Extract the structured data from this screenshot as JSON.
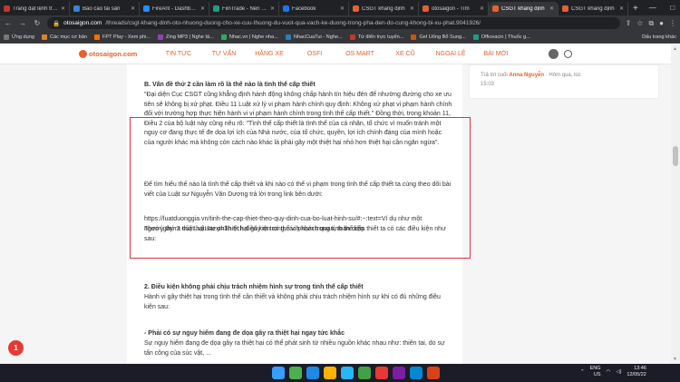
{
  "tabs": [
    {
      "title": "Trang đặt lệnh trực",
      "color": "#c0392b"
    },
    {
      "title": "Báo cáo tài sản",
      "color": "#2e86de"
    },
    {
      "title": "FireAnt - Dashboard",
      "color": "#1e90ff"
    },
    {
      "title": "FiinTrade - Nền tảng",
      "color": "#16a085"
    },
    {
      "title": "Facebook",
      "color": "#1877f2"
    },
    {
      "title": "CSGT khẳng định",
      "color": "#e8612c"
    },
    {
      "title": "otosaigon - Tìm",
      "color": "#e8612c"
    },
    {
      "title": "CSGT khẳng định",
      "color": "#e8612c",
      "active": true
    },
    {
      "title": "CSGT khẳng định",
      "color": "#e8612c"
    }
  ],
  "address": {
    "domain": "otosaigon.com",
    "path": "/threads/csgt-khang-dinh-oto-nhuong-duong-cho-xe-cuu-thuong-du-vuot-qua-vach-ke-duong-trong-pha-den-do-cung-khong-bi-xu-phat.9041926/"
  },
  "bookmarks": [
    {
      "label": "Ứng dụng",
      "color": "#777"
    },
    {
      "label": "Các mục cơ bản",
      "color": "#e67e22"
    },
    {
      "label": "FPT Play - Xem phi...",
      "color": "#ff6f00"
    },
    {
      "label": "Zing MP3 | Nghe tả...",
      "color": "#8e44ad"
    },
    {
      "label": "Nhac.vn | Nghe nha...",
      "color": "#27ae60"
    },
    {
      "label": "NhacCuaTui - Nghe...",
      "color": "#2980b9"
    },
    {
      "label": "Từ điển trực tuyến...",
      "color": "#c0392b"
    },
    {
      "label": "Gel Uống Bổ Sung...",
      "color": "#d35400"
    },
    {
      "label": "Officeacin | Thuốc g...",
      "color": "#16a085"
    }
  ],
  "bookmarks_right": "Dấu trang khác",
  "site": {
    "logo": "otosaigon.com",
    "menu": [
      "TIN TỨC",
      "TƯ VẤN",
      "HÃNG XE",
      "OSFI",
      "OS MART",
      "XE CŨ",
      "NGOẠI LỆ",
      "BÀI MỚI"
    ]
  },
  "sidebar": {
    "reply_prefix": "Trả lời cuối",
    "user": "Anna Nguyễn",
    "reply_suffix": "· Hôm qua, lúc",
    "time": "15:03"
  },
  "article": {
    "heading_b": "B. Vấn đề thứ 2 cần làm rõ là thế nào là tình thế cấp thiết",
    "para_b": "\"Đại diện Cục CSGT cũng khẳng định hành động không chấp hành tín hiệu đèn để nhường đường cho xe ưu tiên sẽ không bị xử phạt. Điều 11 Luật xử lý vi phạm hành chính quy định: Không xử phạt vi phạm hành chính đối với trường hợp thực hiện hành vi vi phạm hành chính trong tình thế cấp thiết.\" Đồng thời, trong khoản 11, Điều 2 của bộ luật này cũng nêu rõ: \"Tình thế cấp thiết là tình thế của cá nhân, tổ chức vì muốn tránh một nguy cơ đang thực tế đe dọa lợi ích của Nhà nước, của tổ chức, quyền, lợi ích chính đáng của mình hoặc của người khác mà không còn cách nào khác là phải gây một thiệt hại nhỏ hơn thiệt hại cần ngăn ngừa\".",
    "para_intro": "Để tìm hiểu thế nào là tình thế cấp thiết và khi nào có thể vi phạm trong tình thế cấp thiết ta cùng theo dõi bài viết của Luật sư Nguyễn Văn Dương trả lời trong link bên dưới:",
    "link": "https://luatduonggia.vn/tinh-the-cap-thiet-theo-quy-dinh-cua-bo-luat-hinh-su/#:~:text=Ví dụ như một người,gây ra thiệt hại.&text=Thiệt hại gây ra trong,cách khách quan, toàn diện.",
    "para_view": "Theo ý thứ 2 của Luật sư phân tích điều kiện có thể vi phạm trong tình thế cấp thiết ta có các điều kiện như sau:",
    "heading_2": "2. Điều kiện không phải chịu trách nhiệm hình sự trong tình thế cấp thiết",
    "para_2": "Hành vi gây thiệt hại trong tình thế cần thiết và không phải chịu trách nhiệm hình sự khi có đủ những điều kiện sau:",
    "heading_danger": "- Phải có sự nguy hiểm đang đe dọa gây ra thiệt hại ngay tức khắc",
    "para_danger": "Sự nguy hiểm đang đe dọa gây ra thiệt hại có thể phát sinh từ nhiều nguồn khác nhau như: thiên tai, do sự tấn công của súc vật, ..."
  },
  "notification_count": "1",
  "taskbar": {
    "lang_1": "ENG",
    "lang_2": "US",
    "time": "13:46",
    "date": "12/05/22",
    "icons": [
      "#4caf50",
      "#1e88e5",
      "#ffb300",
      "#29b6f6",
      "#43a047",
      "#e53935",
      "#7b1fa2",
      "#0288d1",
      "#d84315"
    ]
  }
}
